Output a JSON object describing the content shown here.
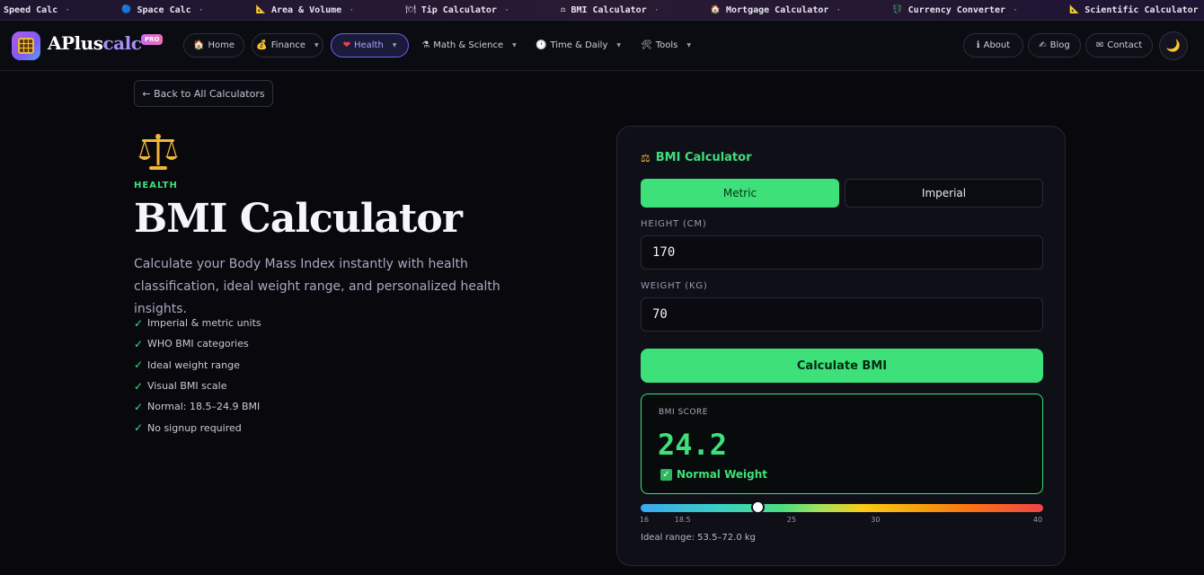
{
  "ticker": [
    {
      "icon": "",
      "label": "Speed Calc"
    },
    {
      "icon": "🔵",
      "label": "Space Calc"
    },
    {
      "icon": "📐",
      "label": "Area & Volume"
    },
    {
      "icon": "🍽",
      "label": "Tip Calculator"
    },
    {
      "icon": "⚖",
      "label": "BMI Calculator"
    },
    {
      "icon": "🏠",
      "label": "Mortgage Calculator"
    },
    {
      "icon": "💱",
      "label": "Currency Converter"
    },
    {
      "icon": "📐",
      "label": "Scientific Calculator"
    }
  ],
  "brand": {
    "name_part1": "APlus",
    "name_part2": "calc",
    "badge": "PRO"
  },
  "nav": {
    "home": "Home",
    "home_icon": "🏠",
    "finance": "Finance",
    "finance_icon": "💰",
    "health": "Health",
    "health_icon": "❤",
    "math": "Math & Science",
    "math_icon": "⚗",
    "time": "Time & Daily",
    "time_icon": "🕐",
    "tools": "Tools",
    "tools_icon": "🛠",
    "about": "About",
    "about_icon": "ℹ",
    "blog": "Blog",
    "blog_icon": "✍",
    "contact": "Contact",
    "contact_icon": "✉",
    "theme_icon": "🌙"
  },
  "back_link": "← Back to All Calculators",
  "hero": {
    "category": "HEALTH",
    "title": "BMI Calculator",
    "description": "Calculate your Body Mass Index instantly with health classification, ideal weight range, and personalized health insights.",
    "features": [
      "Imperial & metric units",
      "WHO BMI categories",
      "Ideal weight range",
      "Visual BMI scale",
      "Normal: 18.5–24.9 BMI",
      "No signup required"
    ]
  },
  "calculator": {
    "title": "BMI Calculator",
    "title_icon": "⚖",
    "units": {
      "metric": "Metric",
      "imperial": "Imperial",
      "selected": "Metric"
    },
    "height_label": "HEIGHT (CM)",
    "height_value": "170",
    "weight_label": "WEIGHT (KG)",
    "weight_value": "70",
    "button": "Calculate BMI",
    "result_label": "BMI SCORE",
    "result_value": "24.2",
    "result_status": "Normal Weight",
    "scale": {
      "min": 16,
      "max": 40,
      "ticks": [
        "16",
        "18.5",
        "25",
        "30",
        "40"
      ],
      "marker": 24.2
    },
    "ideal_range": "Ideal range: 53.5–72.0 kg"
  },
  "colors": {
    "accent": "#3ee07a",
    "brand": "#a98ff8",
    "active_nav": "#6c63f5"
  }
}
